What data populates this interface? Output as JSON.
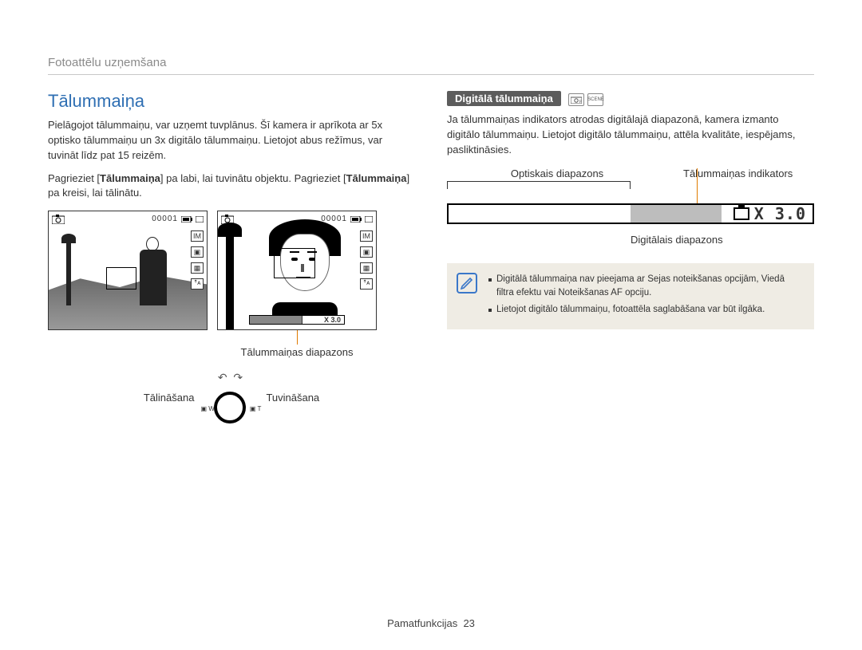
{
  "header": {
    "breadcrumb": "Fotoattēlu uzņemšana"
  },
  "left": {
    "title": "Tālummaiņa",
    "para1": "Pielāgojot tālummaiņu, var uzņemt tuvplānus. Šī kamera ir aprīkota ar 5x optisko tālummaiņu un 3x digitālo tālummaiņu. Lietojot abus režīmus, var tuvināt līdz pat 15 reizēm.",
    "para2_pre": "Pagrieziet [",
    "para2_b1": "Tālummaiņa",
    "para2_mid": "] pa labi, lai tuvinātu objektu. Pagrieziet [",
    "para2_b2": "Tālummaiņa",
    "para2_post": "] pa kreisi, lai tālinātu.",
    "preview_counter": "00001",
    "zoom_bar_text": "X 3.0",
    "callout": "Tālummaiņas diapazons",
    "zoom_out": "Tālināšana",
    "zoom_in": "Tuvināšana"
  },
  "right": {
    "pill": "Digitālā tālummaiņa",
    "para": "Ja tālummaiņas indikators atrodas digitālajā diapazonā, kamera izmanto digitālo tālummaiņu. Lietojot digitālo tālummaiņu, attēla kvalitāte, iespējams, pasliktināsies.",
    "label_optical": "Optiskais diapazons",
    "label_indicator": "Tālummaiņas indikators",
    "x30": "X 3.0",
    "label_digital": "Digitālais diapazons",
    "notes": [
      "Digitālā tālummaiņa nav pieejama ar Sejas noteikšanas opcijām, Viedā filtra efektu vai Noteikšanas AF opciju.",
      "Lietojot digitālo tālummaiņu, fotoattēla saglabāšana var būt ilgāka."
    ]
  },
  "footer": {
    "section": "Pamatfunkcijas",
    "page": "23"
  }
}
